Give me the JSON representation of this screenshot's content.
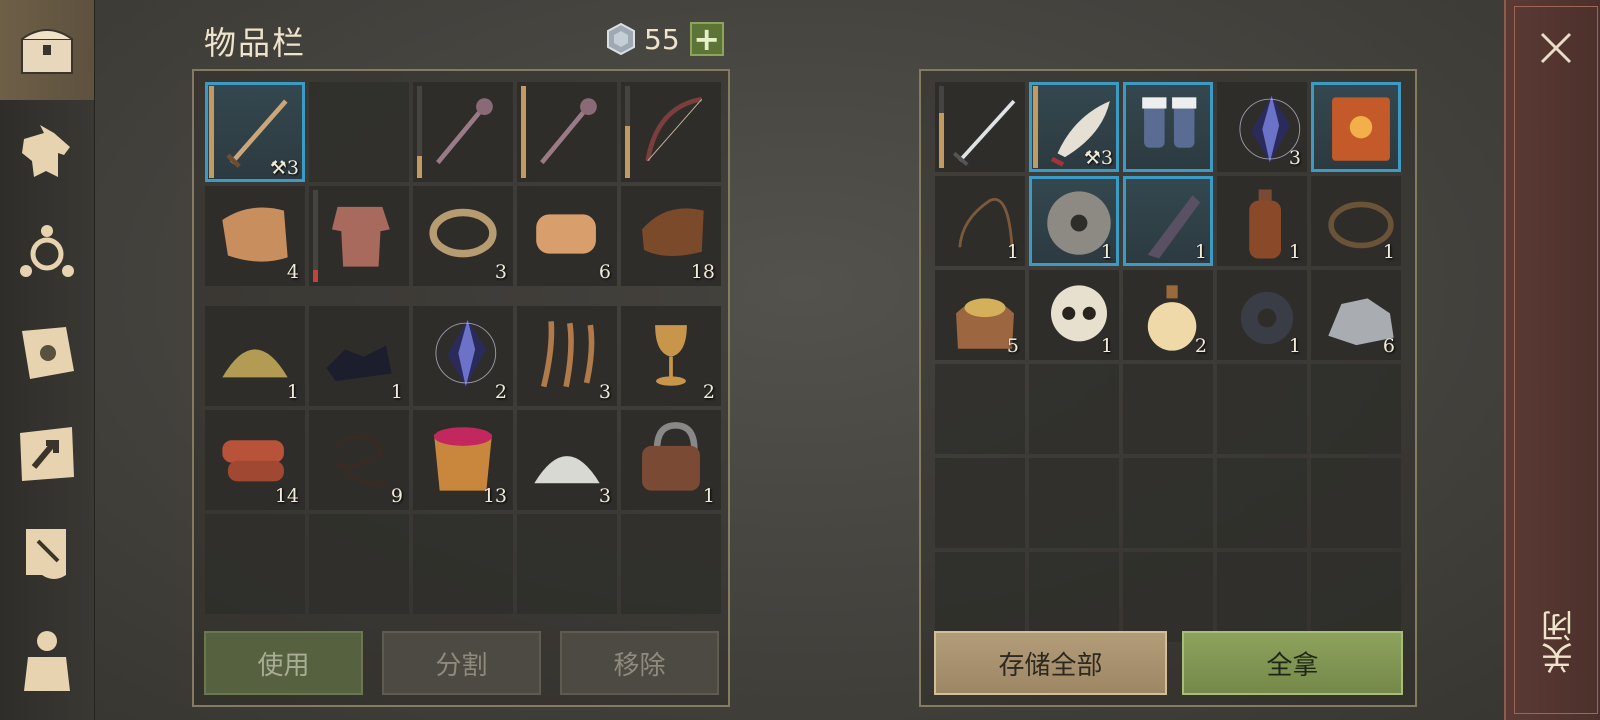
{
  "inventory": {
    "title": "物品栏",
    "currency": {
      "icon": "silver-coin-icon",
      "value": "55"
    },
    "buttons": {
      "use": "使用",
      "split": "分割",
      "remove": "移除"
    },
    "equipment": [
      {
        "icon": "sword-icon",
        "count": "3",
        "badge": "upgrade",
        "highlight": true,
        "durability": 1.0
      },
      {
        "icon": "empty",
        "count": ""
      },
      {
        "icon": "mace-icon",
        "count": "",
        "durability": 0.3
      },
      {
        "icon": "mace-icon",
        "count": "",
        "durability": 1.0
      },
      {
        "icon": "bow-icon",
        "count": "",
        "durability": 0.6
      },
      {
        "icon": "cloth-icon",
        "count": "4"
      },
      {
        "icon": "chainmail-icon",
        "count": "",
        "durability": 0.2
      },
      {
        "icon": "rope-icon",
        "count": "3"
      },
      {
        "icon": "leather-roll-icon",
        "count": "6"
      },
      {
        "icon": "hide-icon",
        "count": "18"
      }
    ],
    "materials": [
      {
        "icon": "sand-pile-icon",
        "count": "1"
      },
      {
        "icon": "coal-icon",
        "count": "1"
      },
      {
        "icon": "crystal-icon",
        "count": "2"
      },
      {
        "icon": "fiber-icon",
        "count": "3"
      },
      {
        "icon": "goblet-icon",
        "count": "2"
      },
      {
        "icon": "meat-icon",
        "count": "14"
      },
      {
        "icon": "string-icon",
        "count": "9"
      },
      {
        "icon": "berry-bucket-icon",
        "count": "13"
      },
      {
        "icon": "salt-pile-icon",
        "count": "3"
      },
      {
        "icon": "padlock-icon",
        "count": "1"
      },
      {
        "icon": "empty",
        "count": ""
      },
      {
        "icon": "empty",
        "count": ""
      },
      {
        "icon": "empty",
        "count": ""
      },
      {
        "icon": "empty",
        "count": ""
      },
      {
        "icon": "empty",
        "count": ""
      }
    ]
  },
  "storage": {
    "items": [
      {
        "icon": "longsword-icon",
        "count": "",
        "durability": 0.7
      },
      {
        "icon": "scimitar-icon",
        "count": "3",
        "badge": "upgrade",
        "highlight": true,
        "durability": 1.0
      },
      {
        "icon": "boots-icon",
        "count": "",
        "highlight": true
      },
      {
        "icon": "crystal-icon",
        "count": "3"
      },
      {
        "icon": "book-icon",
        "count": "",
        "highlight": true
      },
      {
        "icon": "whip-icon",
        "count": "1"
      },
      {
        "icon": "millstone-icon",
        "count": "1",
        "highlight": true
      },
      {
        "icon": "handle-icon",
        "count": "1",
        "highlight": true
      },
      {
        "icon": "bottle-icon",
        "count": "1"
      },
      {
        "icon": "bear-trap-icon",
        "count": "1"
      },
      {
        "icon": "grain-sack-icon",
        "count": "5"
      },
      {
        "icon": "skull-icon",
        "count": "1"
      },
      {
        "icon": "potion-icon",
        "count": "2"
      },
      {
        "icon": "gear-icon",
        "count": "1"
      },
      {
        "icon": "stone-icon",
        "count": "6"
      },
      {
        "icon": "empty",
        "count": ""
      },
      {
        "icon": "empty",
        "count": ""
      },
      {
        "icon": "empty",
        "count": ""
      },
      {
        "icon": "empty",
        "count": ""
      },
      {
        "icon": "empty",
        "count": ""
      },
      {
        "icon": "empty",
        "count": ""
      },
      {
        "icon": "empty",
        "count": ""
      },
      {
        "icon": "empty",
        "count": ""
      },
      {
        "icon": "empty",
        "count": ""
      },
      {
        "icon": "empty",
        "count": ""
      },
      {
        "icon": "empty",
        "count": ""
      },
      {
        "icon": "empty",
        "count": ""
      },
      {
        "icon": "empty",
        "count": ""
      },
      {
        "icon": "empty",
        "count": ""
      },
      {
        "icon": "empty",
        "count": ""
      }
    ],
    "buttons": {
      "store_all": "存储全部",
      "take_all": "全拿"
    }
  },
  "close": {
    "label": "关闭"
  },
  "sidebar": [
    {
      "icon": "chest-icon",
      "active": true
    },
    {
      "icon": "wolf-icon"
    },
    {
      "icon": "crafting-icon"
    },
    {
      "icon": "recipe-book-icon"
    },
    {
      "icon": "map-icon"
    },
    {
      "icon": "quest-scroll-icon"
    },
    {
      "icon": "character-icon"
    }
  ]
}
